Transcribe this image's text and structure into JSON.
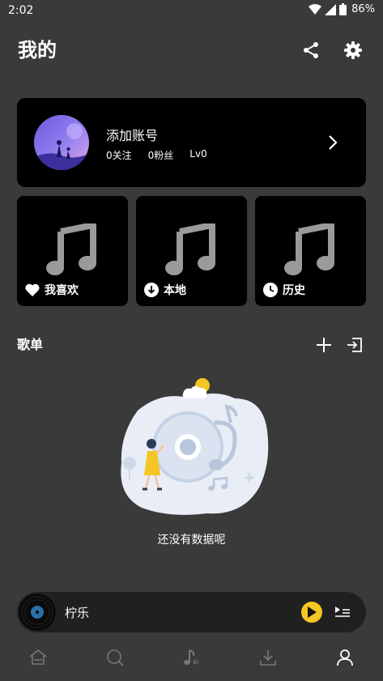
{
  "status_bar": {
    "time": "2:02",
    "battery": "86%"
  },
  "header": {
    "title": "我的",
    "share_icon": "share-icon",
    "settings_icon": "gear-icon"
  },
  "account": {
    "name": "添加账号",
    "following": "0关注",
    "followers": "0粉丝",
    "level": "Lv0"
  },
  "quick_cards": [
    {
      "label": "我喜欢",
      "icon": "heart-icon"
    },
    {
      "label": "本地",
      "icon": "download-circle-icon"
    },
    {
      "label": "历史",
      "icon": "clock-icon"
    }
  ],
  "playlists": {
    "title": "歌单",
    "empty_text": "还没有数据呢"
  },
  "player": {
    "title": "柠乐"
  },
  "bottom_nav": [
    {
      "name": "home",
      "icon": "home-icon",
      "active": false
    },
    {
      "name": "search",
      "icon": "search-icon",
      "active": false
    },
    {
      "name": "ai-music",
      "icon": "music-note-ai-icon",
      "active": false
    },
    {
      "name": "download",
      "icon": "download-icon",
      "active": false
    },
    {
      "name": "profile",
      "icon": "user-icon",
      "active": true
    }
  ],
  "colors": {
    "background": "#3a3a3a",
    "card": "#000000",
    "accent": "#f3c623",
    "player_bg": "#202020"
  }
}
